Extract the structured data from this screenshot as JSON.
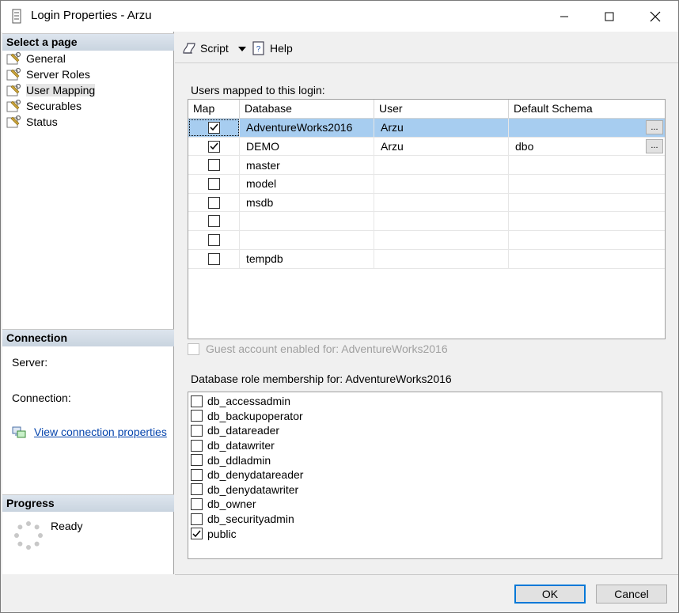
{
  "window": {
    "title": "Login Properties - Arzu",
    "controls": [
      "minimize",
      "maximize",
      "close"
    ]
  },
  "left_pane": {
    "select_page_header": "Select a page",
    "pages": [
      {
        "label": "General",
        "icon": "wrench-page-icon",
        "selected": false
      },
      {
        "label": "Server Roles",
        "icon": "wrench-page-icon",
        "selected": false
      },
      {
        "label": "User Mapping",
        "icon": "wrench-page-icon",
        "selected": true
      },
      {
        "label": "Securables",
        "icon": "wrench-page-icon",
        "selected": false
      },
      {
        "label": "Status",
        "icon": "wrench-page-icon",
        "selected": false
      }
    ],
    "connection_header": "Connection",
    "server_label": "Server:",
    "connection_label": "Connection:",
    "view_connection_link": "View connection properties",
    "progress_header": "Progress",
    "progress_status": "Ready"
  },
  "toolbar": {
    "script_label": "Script",
    "help_label": "Help"
  },
  "users_mapped": {
    "label": "Users mapped to this login:",
    "columns": [
      "Map",
      "Database",
      "User",
      "Default Schema"
    ],
    "rows": [
      {
        "map": true,
        "database": "AdventureWorks2016",
        "user": "Arzu",
        "schema": "",
        "selected": true,
        "ellipsis": true
      },
      {
        "map": true,
        "database": "DEMO",
        "user": "Arzu",
        "schema": "dbo",
        "selected": false,
        "ellipsis": true
      },
      {
        "map": false,
        "database": "master",
        "user": "",
        "schema": "",
        "selected": false,
        "ellipsis": false
      },
      {
        "map": false,
        "database": "model",
        "user": "",
        "schema": "",
        "selected": false,
        "ellipsis": false
      },
      {
        "map": false,
        "database": "msdb",
        "user": "",
        "schema": "",
        "selected": false,
        "ellipsis": false
      },
      {
        "map": false,
        "database": "",
        "user": "",
        "schema": "",
        "selected": false,
        "ellipsis": false
      },
      {
        "map": false,
        "database": "",
        "user": "",
        "schema": "",
        "selected": false,
        "ellipsis": false
      },
      {
        "map": false,
        "database": "tempdb",
        "user": "",
        "schema": "",
        "selected": false,
        "ellipsis": false
      }
    ],
    "ellipsis_label": "..."
  },
  "guest_account": {
    "label": "Guest account enabled for: AdventureWorks2016",
    "checked": false,
    "enabled": false
  },
  "role_membership": {
    "label": "Database role membership for: AdventureWorks2016",
    "roles": [
      {
        "name": "db_accessadmin",
        "checked": false
      },
      {
        "name": "db_backupoperator",
        "checked": false
      },
      {
        "name": "db_datareader",
        "checked": false
      },
      {
        "name": "db_datawriter",
        "checked": false
      },
      {
        "name": "db_ddladmin",
        "checked": false
      },
      {
        "name": "db_denydatareader",
        "checked": false
      },
      {
        "name": "db_denydatawriter",
        "checked": false
      },
      {
        "name": "db_owner",
        "checked": false
      },
      {
        "name": "db_securityadmin",
        "checked": false
      },
      {
        "name": "public",
        "checked": true
      }
    ]
  },
  "buttons": {
    "ok_label": "OK",
    "cancel_label": "Cancel"
  },
  "colors": {
    "selection": "#a7cdf0",
    "link": "#0645ad",
    "default_button_border": "#0078d7"
  }
}
